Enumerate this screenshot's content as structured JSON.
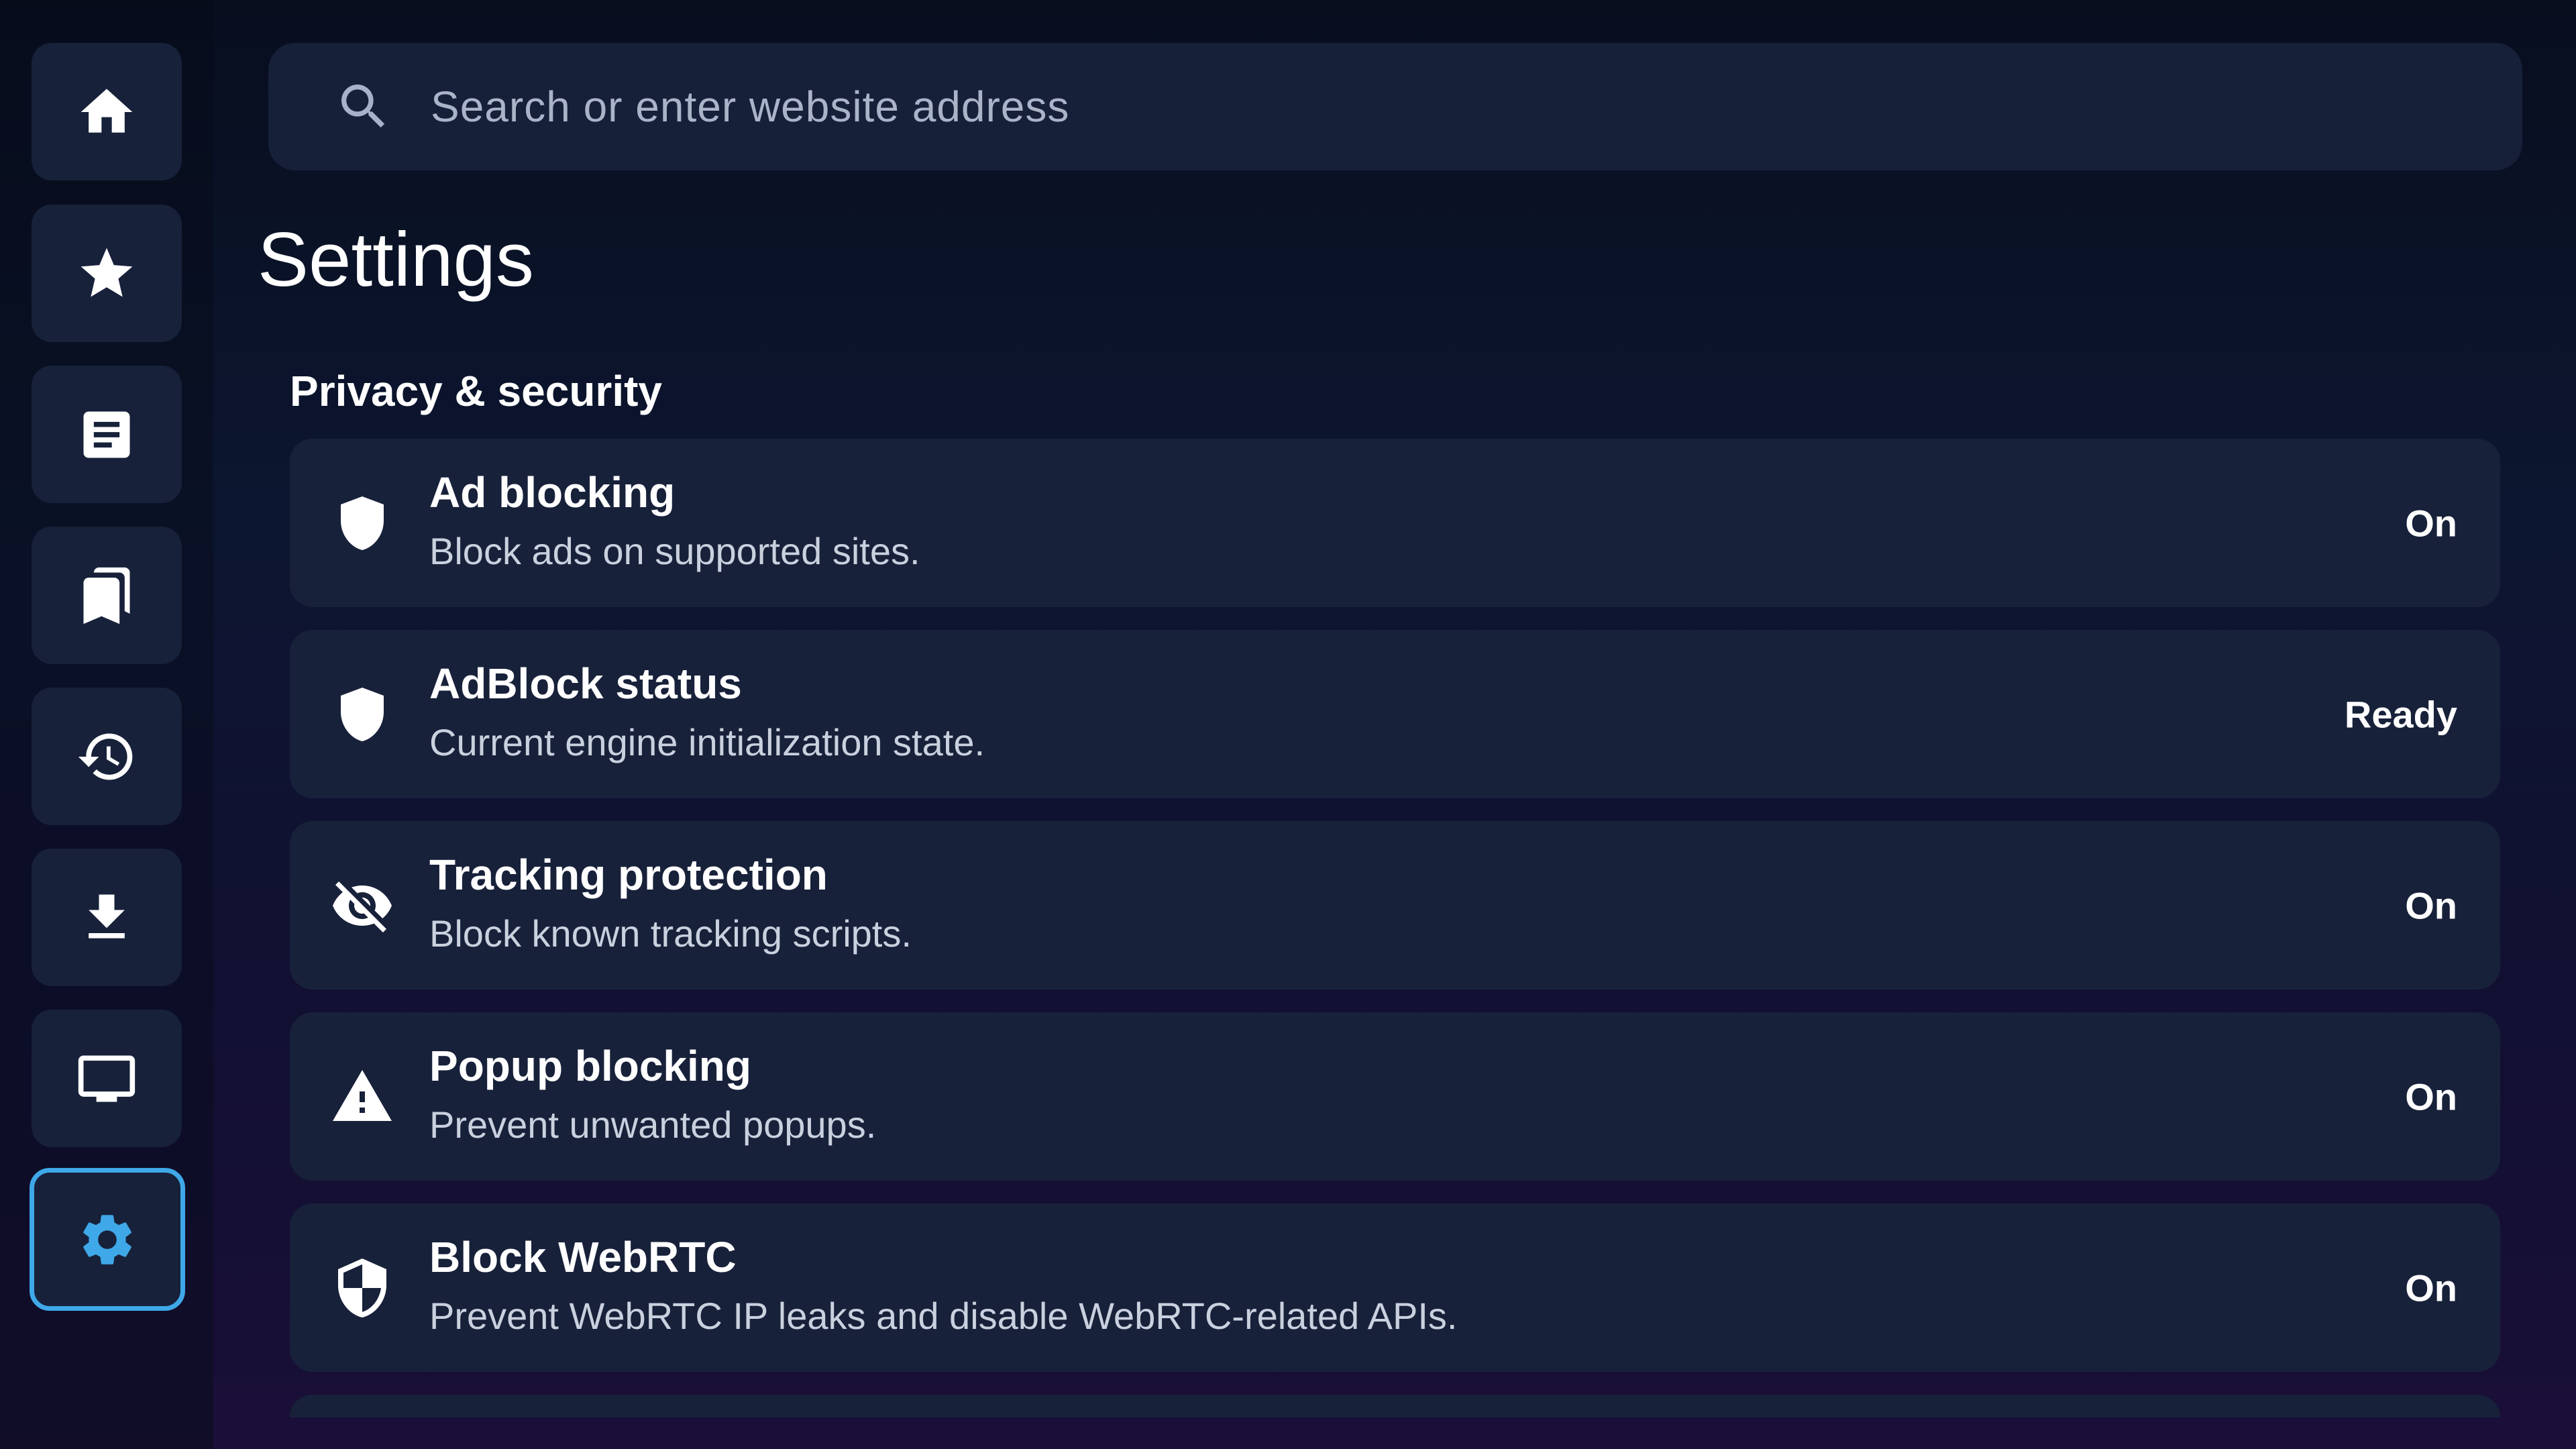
{
  "rail": {
    "items": [
      {
        "name": "home",
        "icon": "home-icon"
      },
      {
        "name": "bookmarks",
        "icon": "star-icon"
      },
      {
        "name": "reading-list",
        "icon": "article-icon"
      },
      {
        "name": "collections",
        "icon": "bookmarks-icon"
      },
      {
        "name": "history",
        "icon": "history-icon"
      },
      {
        "name": "downloads",
        "icon": "download-icon"
      },
      {
        "name": "tv",
        "icon": "tv-icon"
      },
      {
        "name": "settings",
        "icon": "gear-icon",
        "active": true
      }
    ],
    "accent_color": "#3fa8e8"
  },
  "search": {
    "placeholder": "Search or enter website address",
    "value": "",
    "icon": "search-icon"
  },
  "page": {
    "title": "Settings"
  },
  "section": {
    "title": "Privacy & security",
    "items": [
      {
        "icon": "shield-icon",
        "title": "Ad blocking",
        "description": "Block ads on supported sites.",
        "value": "On"
      },
      {
        "icon": "shield-icon",
        "title": "AdBlock status",
        "description": "Current engine initialization state.",
        "value": "Ready"
      },
      {
        "icon": "eye-off-icon",
        "title": "Tracking protection",
        "description": "Block known tracking scripts.",
        "value": "On"
      },
      {
        "icon": "warning-icon",
        "title": "Popup blocking",
        "description": "Prevent unwanted popups.",
        "value": "On"
      },
      {
        "icon": "shield-half-icon",
        "title": "Block WebRTC",
        "description": "Prevent WebRTC IP leaks and disable WebRTC-related APIs.",
        "value": "On"
      }
    ]
  }
}
